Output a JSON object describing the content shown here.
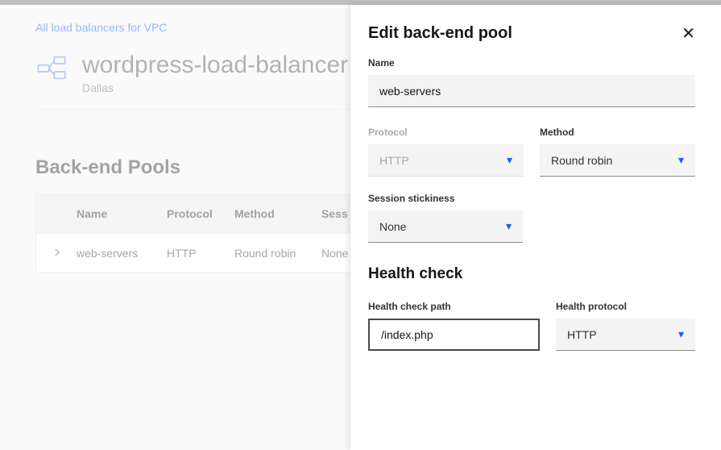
{
  "breadcrumb": "All load balancers for VPC",
  "page_title": "wordpress-load-balancer",
  "region": "Dallas",
  "section_heading": "Back-end Pools",
  "table": {
    "headers": {
      "name": "Name",
      "protocol": "Protocol",
      "method": "Method",
      "session": "Sess"
    },
    "row": {
      "name": "web-servers",
      "protocol": "HTTP",
      "method": "Round robin",
      "session": "None"
    }
  },
  "panel": {
    "title": "Edit back-end pool",
    "name_label": "Name",
    "name_value": "web-servers",
    "protocol_label": "Protocol",
    "protocol_value": "HTTP",
    "method_label": "Method",
    "method_value": "Round robin",
    "stickiness_label": "Session stickiness",
    "stickiness_value": "None",
    "health_heading": "Health check",
    "health_path_label": "Health check path",
    "health_path_value": "/index.php",
    "health_protocol_label": "Health protocol",
    "health_protocol_value": "HTTP"
  }
}
